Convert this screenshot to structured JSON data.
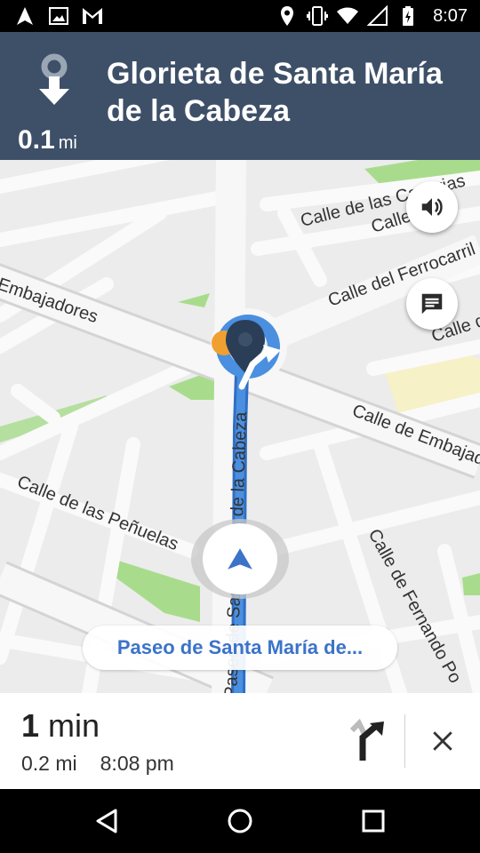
{
  "status_bar": {
    "time": "8:07",
    "icons": [
      "navigation-icon",
      "image-icon",
      "gmail-icon",
      "location-icon",
      "vibrate-icon",
      "wifi-icon",
      "signal-icon",
      "battery-charging-icon"
    ]
  },
  "instruction": {
    "icon": "straight-to-roundabout-icon",
    "distance": "0.1",
    "distance_unit": "mi",
    "destination": "Glorieta de Santa María de la Cabeza"
  },
  "map": {
    "street_labels": [
      "Calle de las Canarias",
      "Calle del Ferrocarril",
      "Embajadores",
      "Calle de Embajadores",
      "Calle de las Peñuelas",
      "Calle de Fernando Po",
      "Paseo de Santa María de la Cabeza",
      "Calle",
      "Calle d"
    ],
    "current_street": "Paseo de Santa María de..."
  },
  "controls": {
    "sound_icon": "volume-icon",
    "report_icon": "chat-bubble-icon",
    "recenter_icon": "navigation-arrow-icon"
  },
  "eta": {
    "minutes": "1",
    "minutes_unit": "min",
    "distance": "0.2 mi",
    "arrival": "8:08 pm"
  },
  "colors": {
    "header_bg": "#3e5068",
    "route": "#4a8fe0",
    "pill_text": "#3b73c9",
    "park": "#a8dc8c",
    "map_bg": "#ececec"
  }
}
